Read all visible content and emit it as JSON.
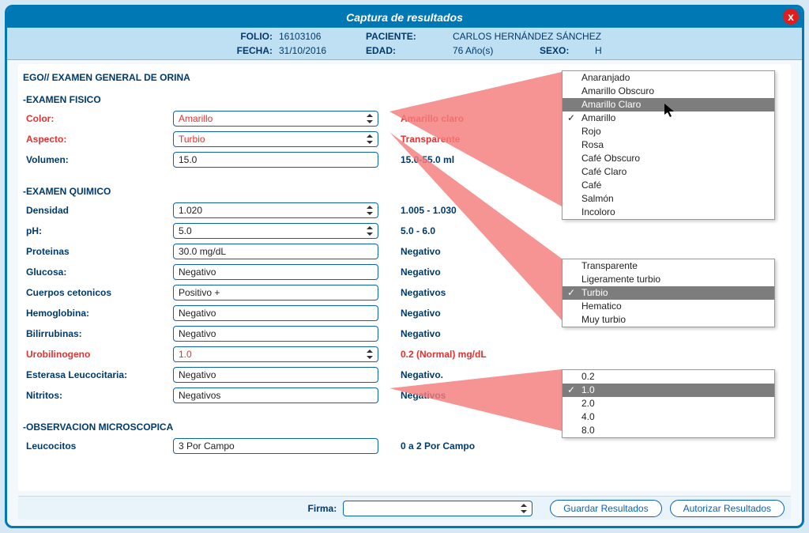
{
  "window": {
    "title": "Captura de resultados",
    "close": "x"
  },
  "patient": {
    "folio_label": "FOLIO:",
    "folio": "16103106",
    "fecha_label": "FECHA:",
    "fecha": "31/10/2016",
    "paciente_label": "PACIENTE:",
    "paciente": "CARLOS HERNÁNDEZ SÁNCHEZ",
    "edad_label": "EDAD:",
    "edad": "76 Año(s)",
    "sexo_label": "SEXO:",
    "sexo": "H"
  },
  "exam_title": "EGO// EXAMEN GENERAL DE ORINA",
  "sections": {
    "fisico": "-EXAMEN FISICO",
    "quimico": "-EXAMEN QUIMICO",
    "micro": "-OBSERVACION MICROSCOPICA"
  },
  "fields": {
    "color": {
      "label": "Color:",
      "value": "Amarillo",
      "ref": "Amarillo claro"
    },
    "aspecto": {
      "label": "Aspecto:",
      "value": "Turbio",
      "ref": "Transparente"
    },
    "volumen": {
      "label": "Volumen:",
      "value": "15.0",
      "ref": "15.0-55.0 ml"
    },
    "densidad": {
      "label": "Densidad",
      "value": "1.020",
      "ref": "1.005 - 1.030"
    },
    "ph": {
      "label": "pH:",
      "value": "5.0",
      "ref": "5.0 - 6.0"
    },
    "proteinas": {
      "label": "Proteinas",
      "value": "30.0 mg/dL",
      "ref": "Negativo"
    },
    "glucosa": {
      "label": "Glucosa:",
      "value": "Negativo",
      "ref": "Negativo"
    },
    "cuerpos": {
      "label": "Cuerpos cetonicos",
      "value": "Positivo +",
      "ref": "Negativos"
    },
    "hemo": {
      "label": "Hemoglobina:",
      "value": "Negativo",
      "ref": "Negativo"
    },
    "bili": {
      "label": "Bilirrubinas:",
      "value": "Negativo",
      "ref": "Negativo"
    },
    "uro": {
      "label": "Urobilinogeno",
      "value": "1.0",
      "ref": "0.2 (Normal) mg/dL"
    },
    "esterasa": {
      "label": "Esterasa Leucocitaria:",
      "value": "Negativo",
      "ref": "Negativo."
    },
    "nitritos": {
      "label": "Nitritos:",
      "value": "Negativos",
      "ref": "Negativos"
    },
    "leuco": {
      "label": "Leucocitos",
      "value": "3 Por Campo",
      "ref": "0 a 2 Por Campo"
    }
  },
  "dropdowns": {
    "color": {
      "options": [
        "Anaranjado",
        "Amarillo Obscuro",
        "Amarillo Claro",
        "Amarillo",
        "Rojo",
        "Rosa",
        "Café Obscuro",
        "Café Claro",
        "Café",
        "Salmón",
        "Incoloro"
      ],
      "highlighted": "Amarillo Claro",
      "checked": "Amarillo"
    },
    "aspecto": {
      "options": [
        "Transparente",
        "Ligeramente turbio",
        "Turbio",
        "Hematico",
        "Muy turbio"
      ],
      "highlighted": "Turbio",
      "checked": "Turbio"
    },
    "uro": {
      "options": [
        "0.2",
        "1.0",
        "2.0",
        "4.0",
        "8.0"
      ],
      "highlighted": "1.0",
      "checked": "1.0"
    }
  },
  "footer": {
    "firma_label": "Firma:",
    "firma_value": "",
    "guardar": "Guardar Resultados",
    "autorizar": "Autorizar Resultados"
  }
}
